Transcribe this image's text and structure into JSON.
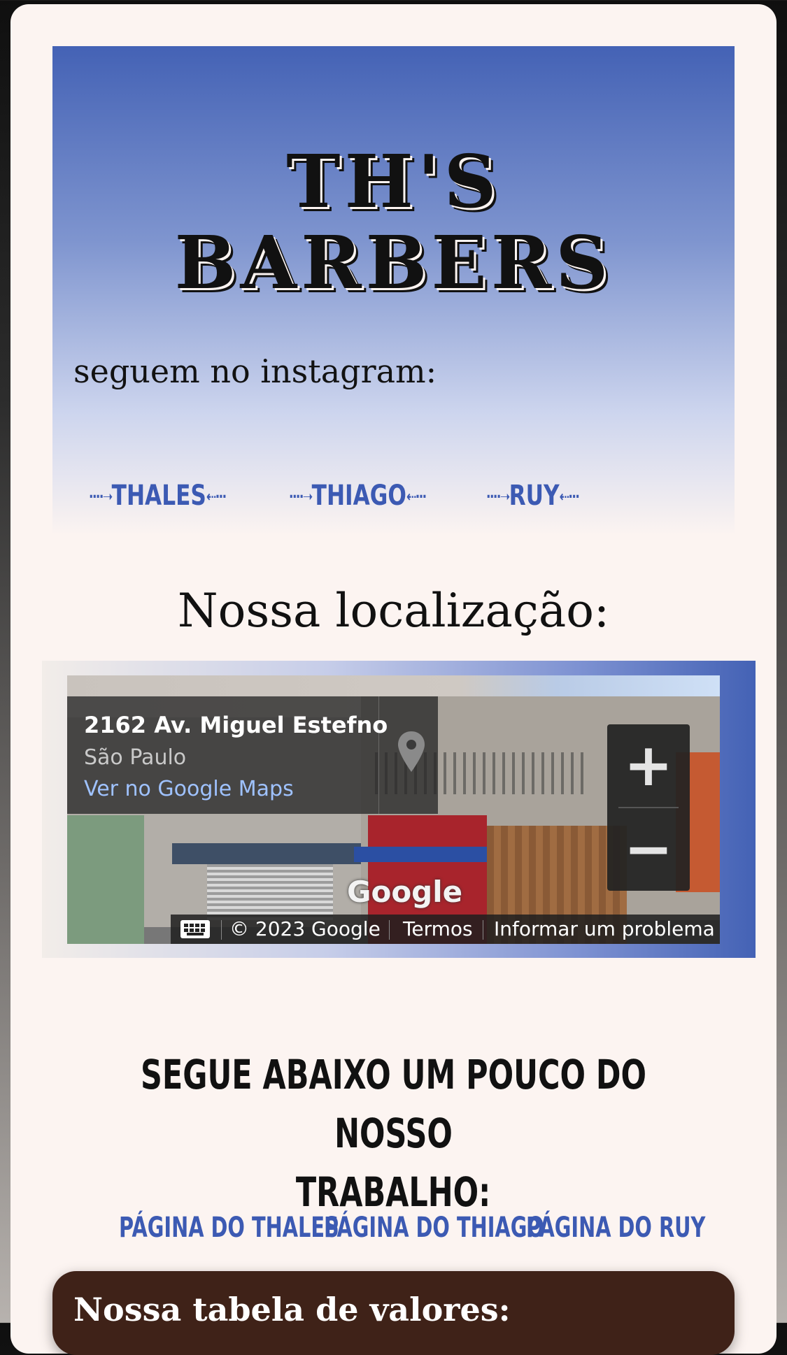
{
  "header": {
    "title_line1": "TH'S",
    "title_line2": "BARBERS",
    "instagram_label": "seguem no instagram:",
    "instagram_links": [
      {
        "label": "THALES",
        "prefix": "····➝",
        "suffix": "⇠···"
      },
      {
        "label": "THIAGO",
        "prefix": "····➝",
        "suffix": "⇠···"
      },
      {
        "label": "RUY",
        "prefix": "····➝",
        "suffix": "⇠···"
      }
    ]
  },
  "location": {
    "title": "Nossa localização:",
    "map": {
      "address": "2162 Av. Miguel Estefno",
      "city": "São Paulo",
      "open_link": "Ver no Google Maps",
      "zoom_in": "+",
      "zoom_out": "−",
      "logo": "Google",
      "copyright": "© 2023 Google",
      "terms": "Termos",
      "report": "Informar um problema"
    }
  },
  "work": {
    "title_line1": "SEGUE ABAIXO UM POUCO DO NOSSO",
    "title_line2": "TRABALHO:",
    "page_links": [
      "PÁGINA DO THALES",
      "PÁGINA DO THIAGO",
      "PÁGINA DO RUY"
    ]
  },
  "prices": {
    "title": "Nossa tabela de valores:"
  },
  "colors": {
    "accent_blue": "#3c5ab3",
    "hero_top": "#4462b5",
    "card_bg": "#fcf4f1",
    "price_bg": "#3f2218"
  }
}
